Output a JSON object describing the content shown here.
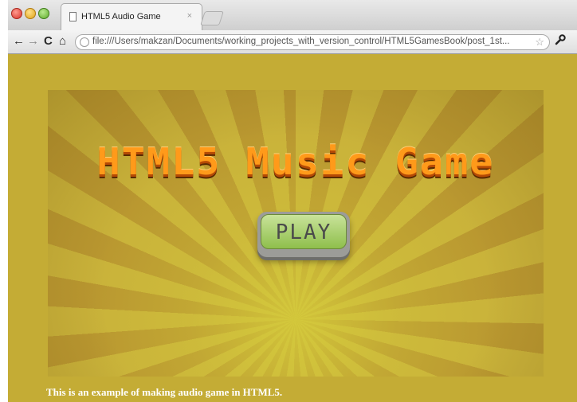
{
  "browser": {
    "tab_title": "HTML5 Audio Game",
    "tab_close": "×",
    "url": "file:///Users/makzan/Documents/working_projects_with_version_control/HTML5GamesBook/post_1st...",
    "nav": {
      "back": "←",
      "forward": "→",
      "reload": "C",
      "home": "⌂",
      "star": "☆",
      "wrench": "🔧"
    }
  },
  "game": {
    "title": "HTML5 Music Game",
    "play_label": "PLAY"
  },
  "caption": "This is an example of making audio game in HTML5.",
  "colors": {
    "background": "#c4ac35",
    "title_orange": "#ff9a1a",
    "play_green": "#9fcc5a"
  }
}
